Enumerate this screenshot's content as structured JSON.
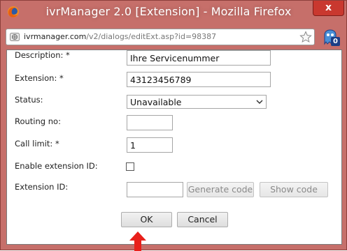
{
  "window": {
    "title": "ivrManager 2.0 [Extension] - Mozilla Firefox",
    "close_label": "x"
  },
  "urlbar": {
    "host": "ivrmanager.com",
    "path": "/v2/dialogs/editExt.asp?id=98387"
  },
  "addon": {
    "badge": "0"
  },
  "form": {
    "description": {
      "label": "Description:",
      "required_mark": "*",
      "value": "Ihre Servicenummer"
    },
    "extension": {
      "label": "Extension:",
      "required_mark": "*",
      "value": "43123456789"
    },
    "status": {
      "label": "Status:",
      "value": "Unavailable"
    },
    "routing_no": {
      "label": "Routing no:",
      "value": ""
    },
    "call_limit": {
      "label": "Call limit:",
      "required_mark": "*",
      "value": "1"
    },
    "enable_extension_id": {
      "label": "Enable extension ID:",
      "checked": false
    },
    "extension_id": {
      "label": "Extension ID:",
      "value": "",
      "generate_label": "Generate code",
      "show_label": "Show code"
    }
  },
  "actions": {
    "ok_label": "OK",
    "cancel_label": "Cancel"
  },
  "colors": {
    "window_chrome": "#c66f6a",
    "close_button": "#c9382f",
    "arrow": "#e8201b",
    "addon_badge": "#1c3e86"
  }
}
